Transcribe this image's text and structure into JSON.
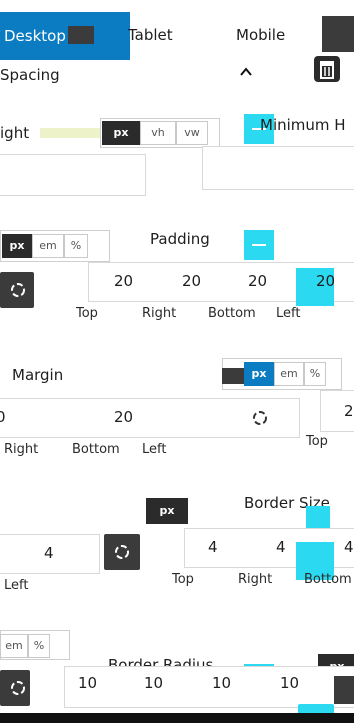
{
  "tabs": {
    "desktop": "Desktop",
    "tablet": "Tablet",
    "mobile": "Mobile"
  },
  "spacing": {
    "title": "Spacing",
    "collapse_icon": "chevron-up-icon",
    "reset_icon": "trash-icon"
  },
  "height": {
    "label": "ight",
    "min_label": "Minimum H",
    "units": [
      "px",
      "vh",
      "vw"
    ]
  },
  "padding": {
    "label": "Padding",
    "units": [
      "px",
      "em",
      "%"
    ],
    "values": [
      "20",
      "20",
      "20",
      "20"
    ],
    "sides": [
      "Top",
      "Right",
      "Bottom",
      "Left"
    ]
  },
  "margin": {
    "label": "Margin",
    "units": [
      "px",
      "em",
      "%"
    ],
    "values": [
      "0",
      "20",
      "2"
    ],
    "sides": [
      "Right",
      "Bottom",
      "Left",
      "Top"
    ]
  },
  "border_size": {
    "label": "Border Size",
    "unit": "px",
    "values": [
      "4",
      "4",
      "4",
      "4"
    ],
    "sides": [
      "Left",
      "Top",
      "Right",
      "Bottom"
    ]
  },
  "border_radius": {
    "label": "Border Radius",
    "units": [
      "em",
      "%",
      "px"
    ],
    "values": [
      "10",
      "10",
      "10",
      "10"
    ]
  },
  "colors": {
    "accent": "#0b7cc1",
    "dark": "#3b3b3b",
    "teal": "#2bd9f0"
  }
}
